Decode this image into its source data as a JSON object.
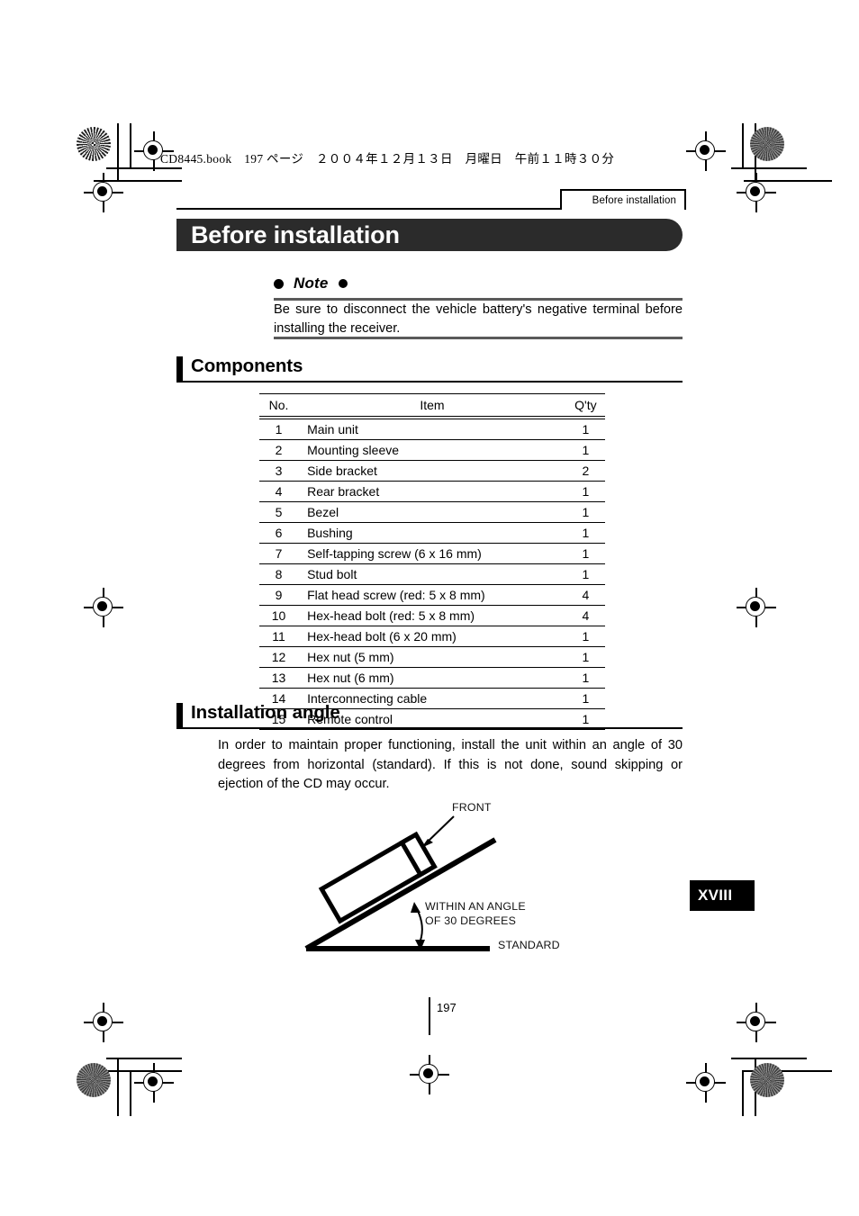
{
  "print_marks": {
    "book_line": "CD8445.book　197 ページ　２００４年１２月１３日　月曜日　午前１１時３０分"
  },
  "running_head": {
    "text": "Before installation"
  },
  "banner": {
    "title": "Before installation"
  },
  "note": {
    "title": "Note",
    "bullet_left": "●",
    "bullet_right": "●",
    "body": "Be sure to disconnect the vehicle battery's negative terminal before installing the receiver."
  },
  "components": {
    "heading": "Components",
    "columns": [
      "No.",
      "Item",
      "Q'ty"
    ],
    "rows": [
      {
        "no": "1",
        "item": "Main unit",
        "qty": "1"
      },
      {
        "no": "2",
        "item": "Mounting sleeve",
        "qty": "1"
      },
      {
        "no": "3",
        "item": "Side bracket",
        "qty": "2"
      },
      {
        "no": "4",
        "item": "Rear bracket",
        "qty": "1"
      },
      {
        "no": "5",
        "item": "Bezel",
        "qty": "1"
      },
      {
        "no": "6",
        "item": "Bushing",
        "qty": "1"
      },
      {
        "no": "7",
        "item": "Self-tapping screw (6 x 16 mm)",
        "qty": "1"
      },
      {
        "no": "8",
        "item": "Stud bolt",
        "qty": "1"
      },
      {
        "no": "9",
        "item": "Flat head screw (red: 5 x 8 mm)",
        "qty": "4"
      },
      {
        "no": "10",
        "item": "Hex-head bolt (red: 5 x 8 mm)",
        "qty": "4"
      },
      {
        "no": "11",
        "item": "Hex-head bolt (6 x 20 mm)",
        "qty": "1"
      },
      {
        "no": "12",
        "item": "Hex nut (5 mm)",
        "qty": "1"
      },
      {
        "no": "13",
        "item": "Hex nut (6 mm)",
        "qty": "1"
      },
      {
        "no": "14",
        "item": "Interconnecting cable",
        "qty": "1"
      },
      {
        "no": "15",
        "item": "Remote control",
        "qty": "1"
      }
    ]
  },
  "installation_angle": {
    "heading": "Installation angle",
    "body": "In order to maintain proper functioning, install the unit within an angle of 30 degrees from horizontal (standard). If this is not done, sound skipping or ejection of the CD may occur.",
    "diagram": {
      "front_label": "FRONT",
      "angle_label_line1": "WITHIN AN ANGLE",
      "angle_label_line2": "OF 30 DEGREES",
      "standard_label": "STANDARD"
    }
  },
  "thumb_index": {
    "label": "XVIII"
  },
  "folio": {
    "page_number": "197"
  },
  "colors": {
    "banner_bg": "#2b2b2b",
    "banner_text": "#ffffff",
    "rule": "#000000",
    "note_rule": "#5a5a5a",
    "thumb_bg": "#000000"
  }
}
